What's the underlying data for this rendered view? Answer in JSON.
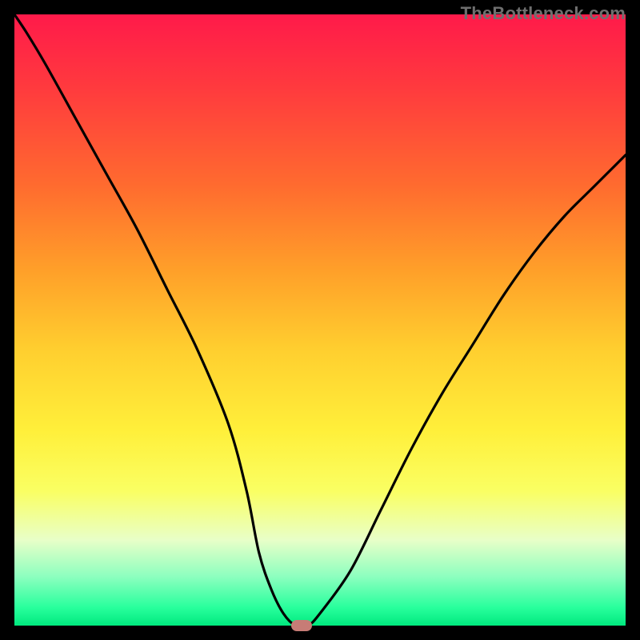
{
  "watermark": "TheBottleneck.com",
  "colors": {
    "frame_bg": "#000000",
    "curve": "#000000",
    "marker": "#c77c76"
  },
  "chart_data": {
    "type": "line",
    "title": "",
    "xlabel": "",
    "ylabel": "",
    "xlim": [
      0,
      100
    ],
    "ylim": [
      0,
      100
    ],
    "x": [
      0,
      2,
      5,
      10,
      15,
      20,
      25,
      30,
      35,
      38,
      40,
      42,
      44,
      46,
      48,
      50,
      55,
      60,
      65,
      70,
      75,
      80,
      85,
      90,
      95,
      100
    ],
    "values": [
      100,
      97,
      92,
      83,
      74,
      65,
      55,
      45,
      33,
      22,
      12,
      6,
      2,
      0,
      0,
      2,
      9,
      19,
      29,
      38,
      46,
      54,
      61,
      67,
      72,
      77
    ],
    "marker": {
      "x": 47,
      "y": 0
    },
    "grid": false,
    "legend": false,
    "notes": "V-shaped bottleneck curve on vertical rainbow gradient; minimum near x≈47%."
  }
}
